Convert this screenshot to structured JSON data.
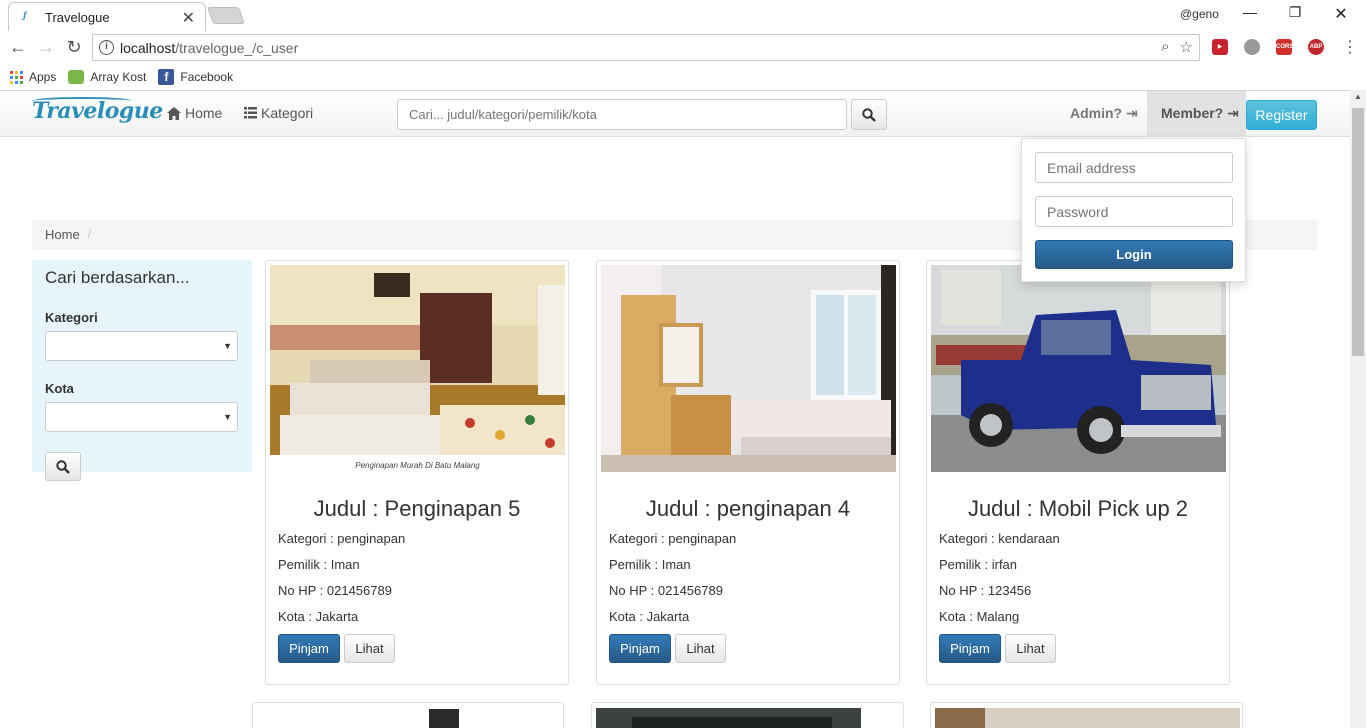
{
  "browser": {
    "tab_title": "Travelogue",
    "tab_favicon_text": "Travelogue",
    "profile_name": "@geno",
    "url_host": "localhost",
    "url_path": "/travelogue_/c_user",
    "extensions": [
      "CORS",
      "ABP"
    ],
    "bookmarks": [
      {
        "label": "Apps",
        "icon": "apps-grid-icon"
      },
      {
        "label": "Array Kost",
        "icon": "array-kost-icon"
      },
      {
        "label": "Facebook",
        "icon": "facebook-icon"
      }
    ]
  },
  "navbar": {
    "brand": "Travelogue",
    "home_label": "Home",
    "kategori_label": "Kategori",
    "search_placeholder": "Cari... judul/kategori/pemilik/kota",
    "admin_label": "Admin?",
    "member_label": "Member?",
    "register_label": "Register"
  },
  "login": {
    "email_placeholder": "Email address",
    "password_placeholder": "Password",
    "login_label": "Login"
  },
  "breadcrumb": {
    "home": "Home",
    "separator": "/"
  },
  "filter": {
    "title": "Cari berdasarkan...",
    "kategori_label": "Kategori",
    "kota_label": "Kota"
  },
  "cards": [
    {
      "title": "Judul : Penginapan 5",
      "kategori": "Kategori : penginapan",
      "pemilik": "Pemilik : Iman",
      "nohp": "No HP : 021456789",
      "kota": "Kota : Jakarta",
      "image_caption": "Penginapan Murah Di Batu Malang",
      "pinjam": "Pinjam",
      "lihat": "Lihat"
    },
    {
      "title": "Judul : penginapan 4",
      "kategori": "Kategori : penginapan",
      "pemilik": "Pemilik : Iman",
      "nohp": "No HP : 021456789",
      "kota": "Kota : Jakarta",
      "pinjam": "Pinjam",
      "lihat": "Lihat"
    },
    {
      "title": "Judul : Mobil Pick up 2",
      "kategori": "Kategori : kendaraan",
      "pemilik": "Pemilik : irfan",
      "nohp": "No HP : 123456",
      "kota": "Kota : Malang",
      "pinjam": "Pinjam",
      "lihat": "Lihat"
    }
  ],
  "colors": {
    "brand": "#2a8fb8",
    "primary": "#337ab7",
    "info": "#5bc0de",
    "filter_bg": "#e8f4fc"
  }
}
